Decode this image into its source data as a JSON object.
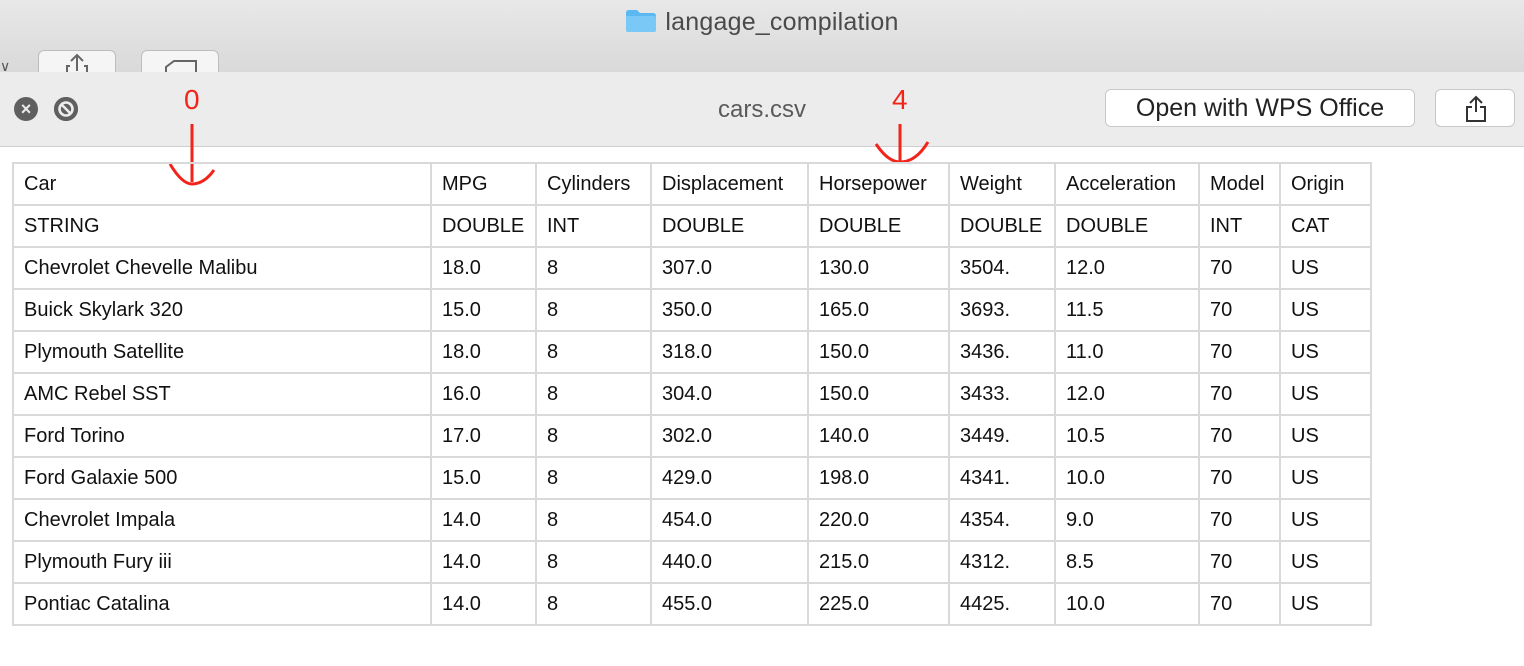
{
  "finder": {
    "title": "langage_compilation"
  },
  "quicklook": {
    "file_name": "cars.csv",
    "open_with_label": "Open with WPS Office",
    "close_icon": "close-icon",
    "fullscreen_icon": "no-entry-icon",
    "share_icon": "share-icon"
  },
  "annotations": {
    "left_label": "0",
    "right_label": "4",
    "color": "#f2241a"
  },
  "table": {
    "headers": [
      "Car",
      "MPG",
      "Cylinders",
      "Displacement",
      "Horsepower",
      "Weight",
      "Acceleration",
      "Model",
      "Origin"
    ],
    "types": [
      "STRING",
      "DOUBLE",
      "INT",
      "DOUBLE",
      "DOUBLE",
      "DOUBLE",
      "DOUBLE",
      "INT",
      "CAT"
    ],
    "rows": [
      [
        "Chevrolet Chevelle Malibu",
        "18.0",
        "8",
        "307.0",
        "130.0",
        "3504.",
        "12.0",
        "70",
        "US"
      ],
      [
        "Buick Skylark 320",
        "15.0",
        "8",
        "350.0",
        "165.0",
        "3693.",
        "11.5",
        "70",
        "US"
      ],
      [
        "Plymouth Satellite",
        "18.0",
        "8",
        "318.0",
        "150.0",
        "3436.",
        "11.0",
        "70",
        "US"
      ],
      [
        "AMC Rebel SST",
        "16.0",
        "8",
        "304.0",
        "150.0",
        "3433.",
        "12.0",
        "70",
        "US"
      ],
      [
        "Ford Torino",
        "17.0",
        "8",
        "302.0",
        "140.0",
        "3449.",
        "10.5",
        "70",
        "US"
      ],
      [
        "Ford Galaxie 500",
        "15.0",
        "8",
        "429.0",
        "198.0",
        "4341.",
        "10.0",
        "70",
        "US"
      ],
      [
        "Chevrolet Impala",
        "14.0",
        "8",
        "454.0",
        "220.0",
        "4354.",
        "9.0",
        "70",
        "US"
      ],
      [
        "Plymouth Fury iii",
        "14.0",
        "8",
        "440.0",
        "215.0",
        "4312.",
        "8.5",
        "70",
        "US"
      ],
      [
        "Pontiac Catalina",
        "14.0",
        "8",
        "455.0",
        "225.0",
        "4425.",
        "10.0",
        "70",
        "US"
      ]
    ]
  }
}
